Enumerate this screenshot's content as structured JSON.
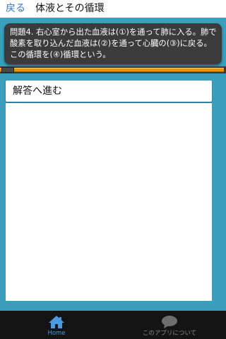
{
  "header": {
    "back_label": "戻る",
    "title": "体液とその循環"
  },
  "question": {
    "text": "問題4. 右心室から出た血液は(①)を通って肺に入る。肺で酸素を取り込んだ血液は(②)を通って心臓の(③)に戻る。この循環を(④)循環という。"
  },
  "progress": {
    "fraction": 0.99
  },
  "answer": {
    "label": "解答へ進む"
  },
  "tabbar": {
    "home_label": "Home",
    "about_label": "このアプリについて",
    "home_icon": "home-icon",
    "about_icon": "speech-bubble-icon"
  },
  "colors": {
    "background": "#3a9fbd",
    "back_link": "#3a78c8",
    "progress_fill": "#e8950a",
    "tab_active": "#4a9ae0"
  }
}
